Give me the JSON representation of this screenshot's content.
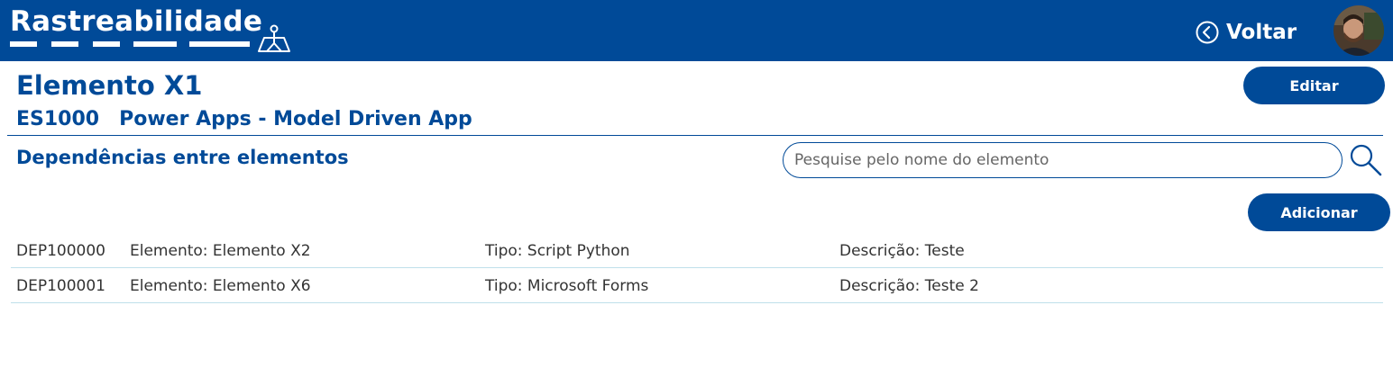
{
  "header": {
    "brand": "Rastreabilidade",
    "back_label": "Voltar"
  },
  "element": {
    "title": "Elemento X1",
    "code": "ES1000",
    "name": "Power Apps - Model Driven App"
  },
  "actions": {
    "edit_label": "Editar",
    "add_label": "Adicionar"
  },
  "dependencies": {
    "section_title": "Dependências entre elementos",
    "search_placeholder": "Pesquise pelo nome do elemento",
    "rows": [
      {
        "id": "DEP100000",
        "element": "Elemento: Elemento X2",
        "type": "Tipo: Script Python",
        "description": "Descrição: Teste"
      },
      {
        "id": "DEP100001",
        "element": "Elemento: Elemento X6",
        "type": "Tipo: Microsoft Forms",
        "description": "Descrição: Teste 2"
      }
    ]
  },
  "colors": {
    "primary": "#004a98",
    "row_border": "#bfe0ea"
  },
  "icons": {
    "brand": "map-route-icon",
    "back": "chevron-left-circle-icon",
    "search": "search-icon"
  }
}
